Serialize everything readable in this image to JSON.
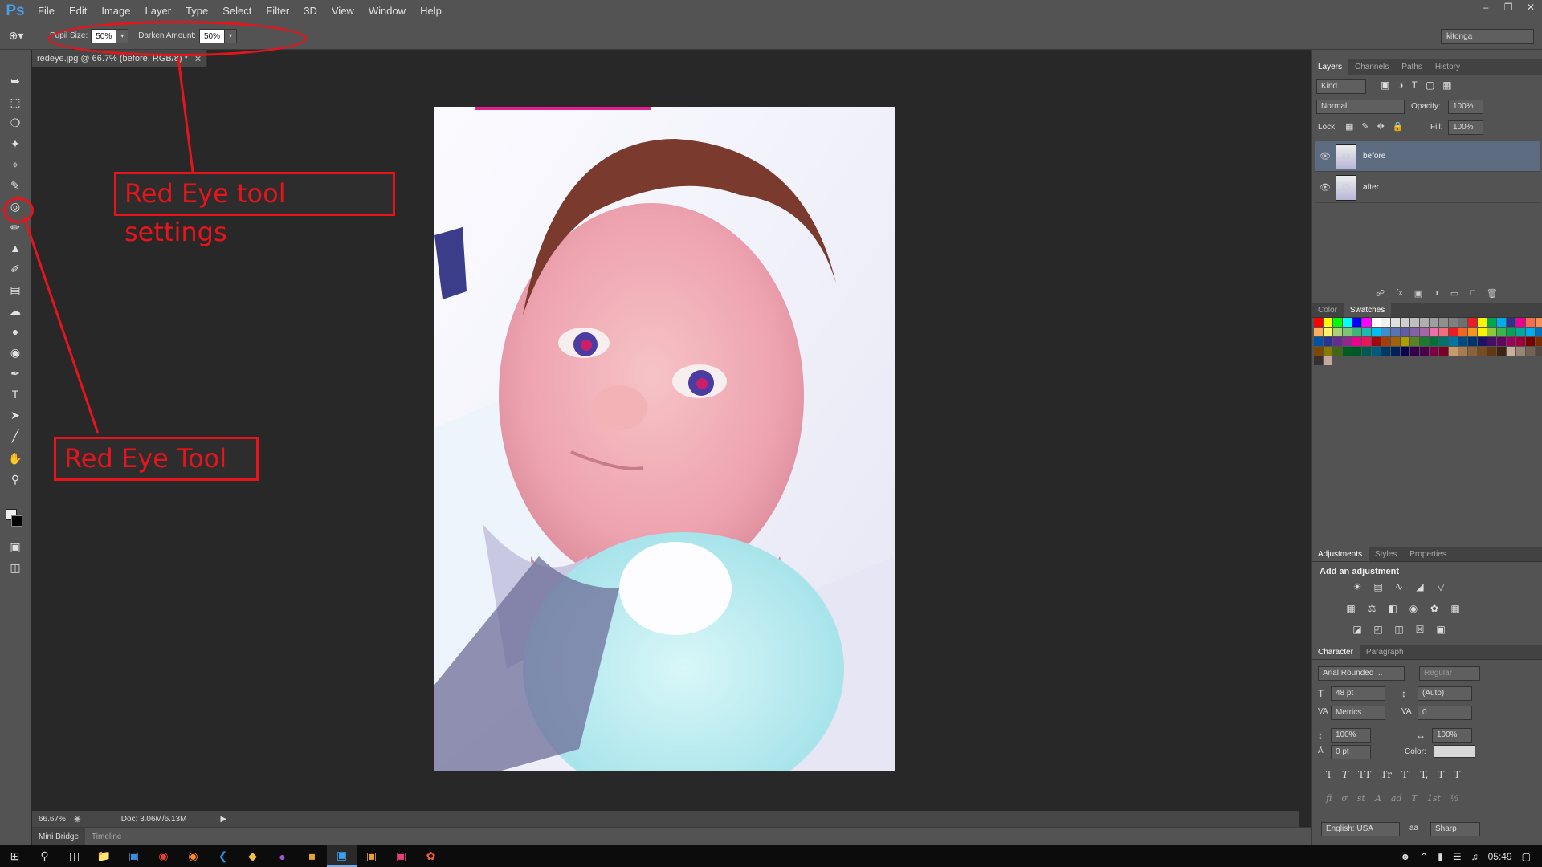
{
  "app": {
    "logo": "Ps"
  },
  "menu": [
    "File",
    "Edit",
    "Image",
    "Layer",
    "Type",
    "Select",
    "Filter",
    "3D",
    "View",
    "Window",
    "Help"
  ],
  "options": {
    "tool_icon": "red-eye-tool-icon",
    "pupil_label": "Pupil Size:",
    "pupil_value": "50%",
    "darken_label": "Darken Amount:",
    "darken_value": "50%",
    "workspace": "kitonga"
  },
  "document": {
    "tab_title": "redeye.jpg @ 66.7% (before, RGB/8) *",
    "zoom": "66.67%",
    "doc_size": "Doc: 3.06M/6.13M"
  },
  "bottom_tabs": [
    "Mini Bridge",
    "Timeline"
  ],
  "layers_panel": {
    "tabs": [
      "Layers",
      "Channels",
      "Paths",
      "History"
    ],
    "kind": "Kind",
    "blend": "Normal",
    "opacity_label": "Opacity:",
    "opacity": "100%",
    "lock_label": "Lock:",
    "fill_label": "Fill:",
    "fill": "100%",
    "layers": [
      {
        "name": "before"
      },
      {
        "name": "after"
      }
    ]
  },
  "color_panel": {
    "tabs": [
      "Color",
      "Swatches"
    ]
  },
  "swatch_colors": [
    "#ff0000",
    "#ffff00",
    "#00ff00",
    "#00ffff",
    "#0000ff",
    "#ff00ff",
    "#ffffff",
    "#f0f0f0",
    "#e0e0e0",
    "#cfcfcf",
    "#bfbfbf",
    "#afafaf",
    "#9f9f9f",
    "#8f8f8f",
    "#7f7f7f",
    "#6f6f6f",
    "#ed1c24",
    "#fff200",
    "#00a651",
    "#00aeef",
    "#2e3192",
    "#ec008c",
    "#f26c4f",
    "#f68e56",
    "#fbaf5d",
    "#fff568",
    "#acd373",
    "#7cc576",
    "#3bb878",
    "#1abbb4",
    "#00bff3",
    "#438ccb",
    "#5574b9",
    "#605ca8",
    "#8560a8",
    "#a864a8",
    "#f06eaa",
    "#f26d7d",
    "#ed1c24",
    "#f26522",
    "#f7941d",
    "#fff200",
    "#8dc63f",
    "#39b54a",
    "#00a651",
    "#00a99d",
    "#00aeef",
    "#0072bc",
    "#0054a6",
    "#2e3192",
    "#662d91",
    "#92278f",
    "#ec008c",
    "#ed145b",
    "#9e0b0f",
    "#a0410d",
    "#a36209",
    "#aba000",
    "#598527",
    "#1a7b30",
    "#007236",
    "#00746b",
    "#0076a3",
    "#004b80",
    "#003471",
    "#1b1464",
    "#440e62",
    "#630460",
    "#9e005d",
    "#9e0039",
    "#790000",
    "#7b2e00",
    "#7d4900",
    "#827b00",
    "#406618",
    "#005e20",
    "#005826",
    "#005952",
    "#005b7f",
    "#003663",
    "#002157",
    "#0d004c",
    "#32004b",
    "#4b0049",
    "#7b0046",
    "#7a0026",
    "#c69c6d",
    "#a67c52",
    "#8c6239",
    "#754c24",
    "#603913",
    "#3c2415",
    "#c7b299",
    "#998675",
    "#736357",
    "#534741",
    "#362f2d",
    "#c4a8a0"
  ],
  "adjust_panel": {
    "tabs": [
      "Adjustments",
      "Styles",
      "Properties"
    ],
    "heading": "Add an adjustment"
  },
  "character_panel": {
    "tabs": [
      "Character",
      "Paragraph"
    ],
    "font": "Arial Rounded ...",
    "style": "Regular",
    "size": "48 pt",
    "leading": "(Auto)",
    "kerning": "Metrics",
    "tracking": "0",
    "vscale": "100%",
    "hscale": "100%",
    "baseline": "0 pt",
    "color_label": "Color:",
    "language": "English: USA",
    "antialias": "Sharp",
    "type_buttons": [
      "T",
      "T",
      "TT",
      "Tr",
      "T'",
      "T,",
      "T",
      "T"
    ],
    "ot_buttons": [
      "fi",
      "σ",
      "st",
      "A",
      "ad",
      "T",
      "1st",
      "½"
    ]
  },
  "annotations": {
    "settings": "Red Eye tool settings",
    "tool": "Red Eye Tool"
  },
  "taskbar": {
    "clock": "05:49"
  }
}
